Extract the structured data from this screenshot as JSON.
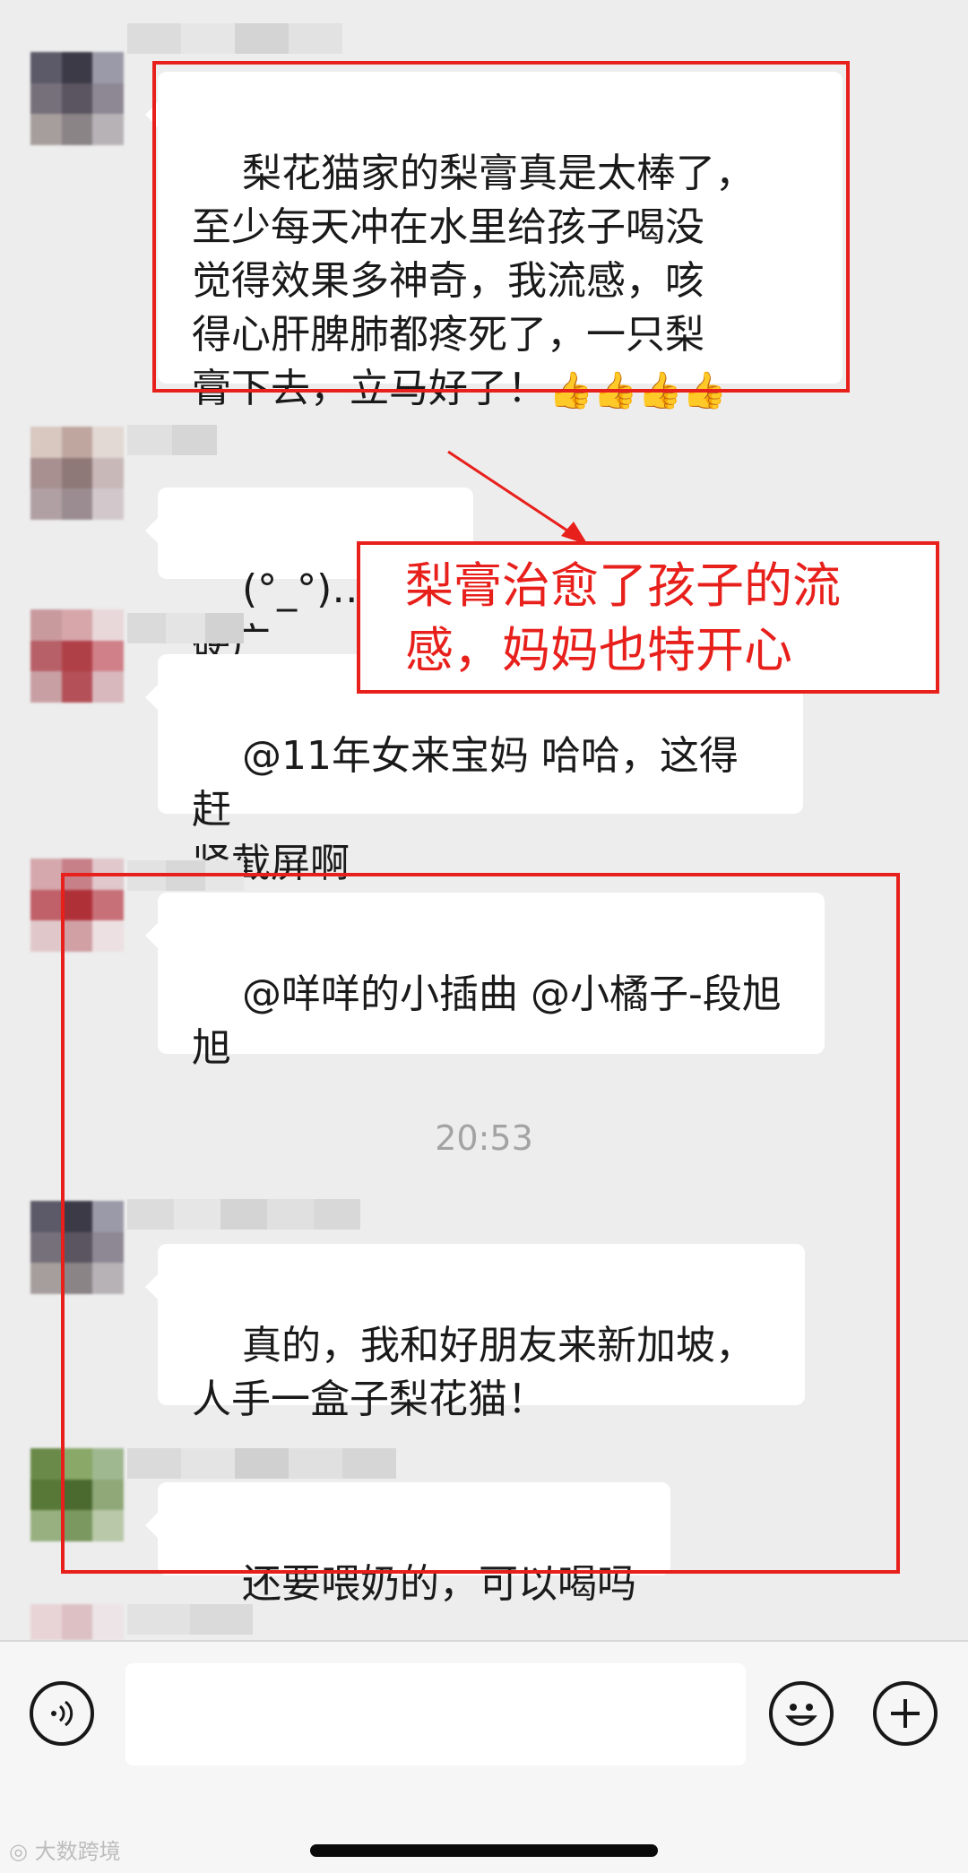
{
  "messages": [
    {
      "text": "梨花猫家的梨膏真是太棒了，\n至少每天冲在水里给孩子喝没\n觉得效果多神奇，我流感，咳\n得心肝脾肺都疼死了，一只梨\n膏下去，立马好了！",
      "emoji": "👍👍👍👍"
    },
    {
      "text": "(°_°)…，硬广"
    },
    {
      "text": "@11年女来宝妈 哈哈，这得赶\n紧截屏啊"
    },
    {
      "text": "@咩咩的小插曲 @小橘子-段旭\n旭"
    },
    {
      "text": "真的，我和好朋友来新加坡，\n人手一盒子梨花猫！"
    },
    {
      "text": "还要喂奶的，可以喝吗"
    }
  ],
  "timestamp": "20:53",
  "annotation": {
    "line1": "梨膏治愈了孩子的流",
    "line2": "感，妈妈也特开心"
  },
  "input_bar": {
    "voice_icon": "voice-icon",
    "emoji_icon": "emoji-icon",
    "add_icon": "add-icon"
  },
  "watermark": "大数跨境",
  "colors": {
    "highlight": "#e8201c",
    "background": "#ededed"
  }
}
